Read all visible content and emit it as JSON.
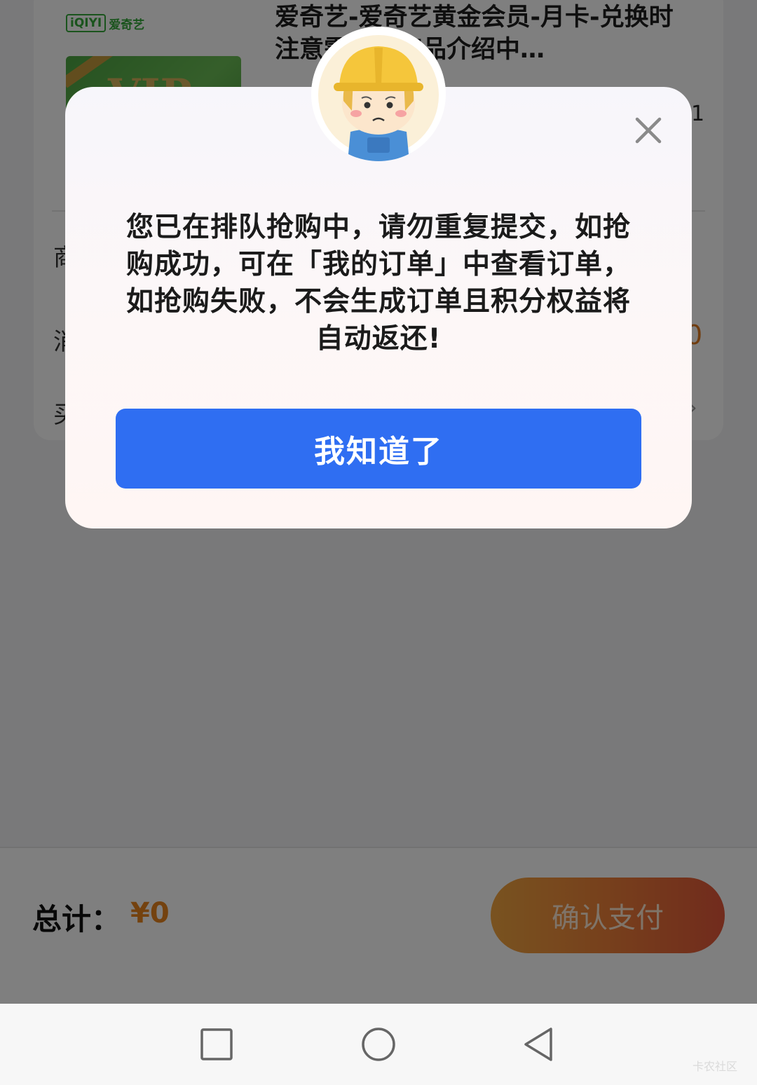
{
  "product": {
    "brand_box": "iQIYI",
    "brand_name": "爱奇艺",
    "thumb_text": "VIP",
    "title": "爱奇艺-爱奇艺黄金会员-月卡-兑换时注意需扫描商品介绍中…",
    "quantity": "1",
    "row_labels": [
      "商",
      "消",
      "买"
    ],
    "price_fragment": "0",
    "arrow": "›"
  },
  "footer": {
    "total_label": "总计：",
    "total_value": "¥0",
    "pay_label": "确认支付"
  },
  "dialog": {
    "message": "您已在排队抢购中，请勿重复提交，如抢购成功，可在「我的订单」中查看订单，如抢购失败，不会生成订单且积分权益将自动返还!",
    "button_label": "我知道了",
    "close_icon": "close-icon",
    "avatar_icon": "worker-avatar-icon"
  },
  "nav": {
    "icons": [
      "recents-square-icon",
      "home-circle-icon",
      "back-triangle-icon"
    ]
  },
  "watermark": "卡农社区",
  "colors": {
    "primary_button": "#2f6ef2",
    "pay_gradient_start": "#f2a640",
    "pay_gradient_end": "#e3573a",
    "price_orange": "#e8851e"
  }
}
